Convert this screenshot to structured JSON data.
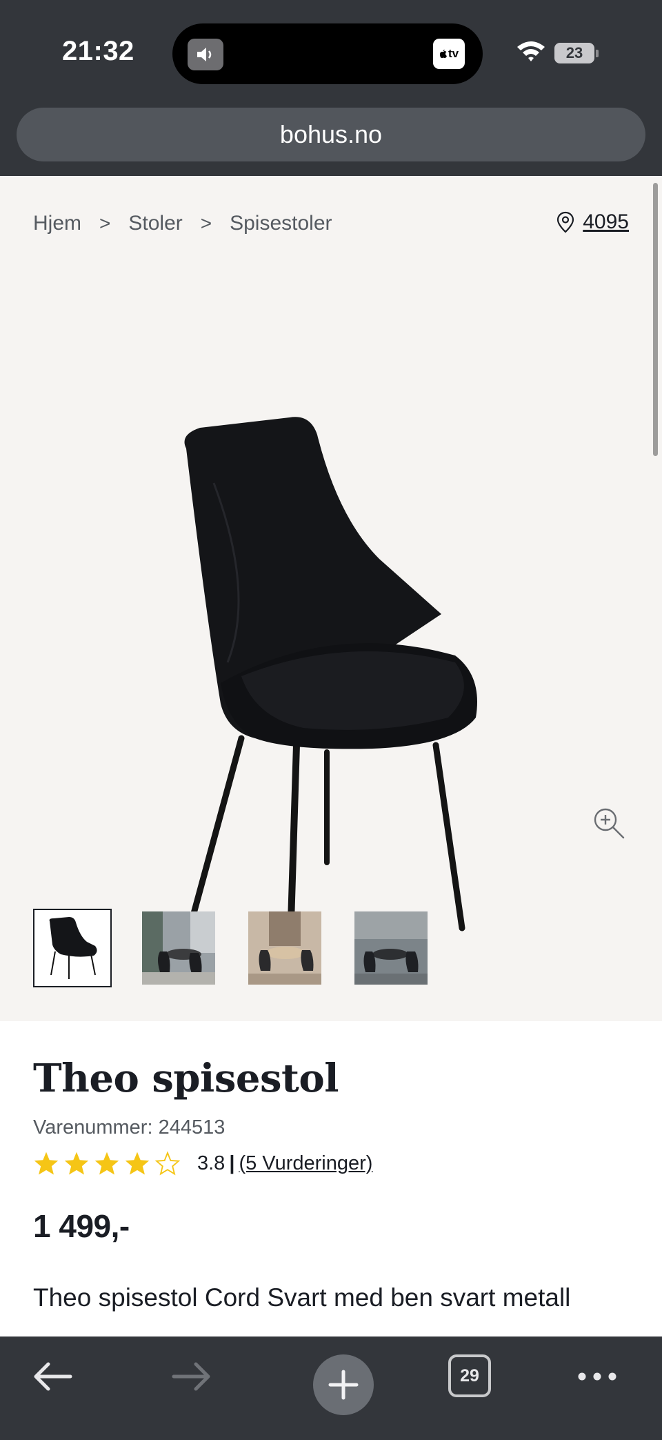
{
  "status_bar": {
    "time": "21:32",
    "battery": "23",
    "island_app": "tv"
  },
  "browser": {
    "url": "bohus.no",
    "tab_count": "29"
  },
  "breadcrumb": {
    "items": [
      "Hjem",
      "Stoler",
      "Spisestoler"
    ],
    "separator": ">"
  },
  "store": {
    "code": "4095"
  },
  "gallery": {
    "thumbnail_count": 4,
    "active_index": 0
  },
  "product": {
    "title": "Theo spisestol",
    "sku": "Varenummer: 244513",
    "rating_value": "3.8",
    "rating_separator": "|",
    "reviews_label": "(5 Vurderinger)",
    "stars_filled": 4,
    "stars_total": 5,
    "price": "1 499,-",
    "description": "Theo spisestol Cord Svart med ben svart metall"
  },
  "colors": {
    "chrome": "#33363b",
    "gallery_bg": "#f6f4f2",
    "star": "#f5c516",
    "text": "#1a1d24"
  },
  "icons": {
    "location": "map-pin-icon",
    "zoom": "zoom-in-icon",
    "back": "arrow-left-icon",
    "forward": "arrow-right-icon",
    "new_tab": "plus-icon",
    "tabs": "tabs-icon",
    "more": "more-dots-icon"
  }
}
